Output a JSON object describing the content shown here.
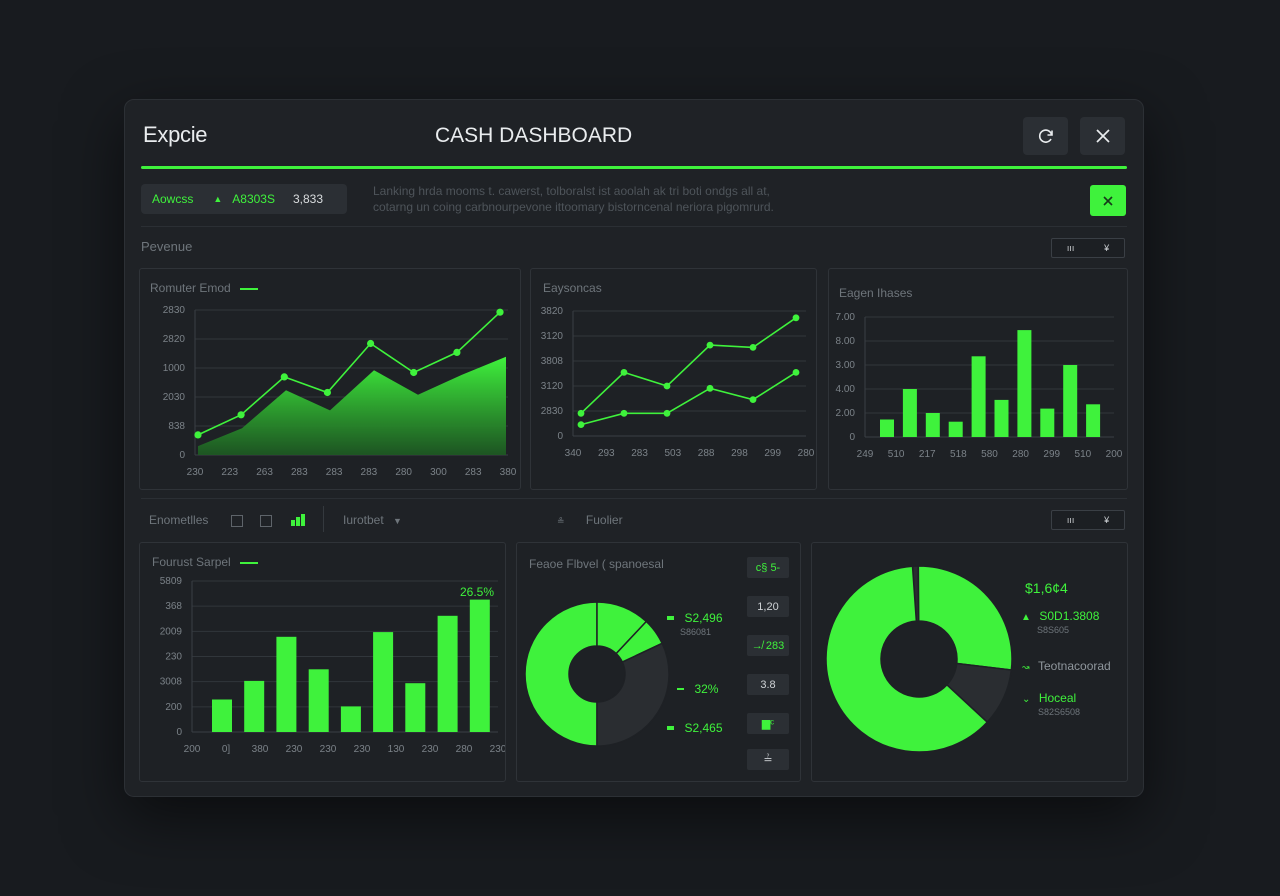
{
  "app": {
    "brand": "Expcie",
    "title": "CASH DASHBOARD"
  },
  "header": {
    "refresh_icon": "refresh-icon",
    "close_icon": "close-icon"
  },
  "summary": {
    "label1": "Aowcss",
    "label2": "A8303S",
    "value": "3,833",
    "description_line1": "Lanking hrda mooms t. cawerst, tolboralst ist aoolah ak tri boti ondgs all at,",
    "description_line2": "cotarng un coing carbnourpevone ittoomary bistorncenal neriora pigomrurd."
  },
  "sections": {
    "top": {
      "label": "Pevenue",
      "control_left": "ııı",
      "control_right": "¥"
    },
    "bottom": {
      "label": "Enometlles",
      "filter_label": "Iurotbet",
      "other_label": "Fuolier",
      "control_left": "ııı",
      "control_right": "¥"
    }
  },
  "colors": {
    "accent": "#3ff23c",
    "panel": "#1e2125",
    "grid": "#31363b"
  },
  "chart_data": [
    {
      "type": "area",
      "title": "Romuter Emod",
      "y_ticks": [
        "2830",
        "2820",
        "1000",
        "2030",
        "838",
        "0"
      ],
      "x_ticks": [
        "230",
        "223",
        "263",
        "283",
        "283",
        "283",
        "280",
        "300",
        "283",
        "380"
      ],
      "series": [
        {
          "values": [
            0.9,
            1.8,
            3.5,
            2.8,
            5.0,
            3.7,
            4.6,
            6.4
          ]
        },
        {
          "values": [
            0.4,
            1.2,
            2.9,
            2.0,
            3.8,
            2.7,
            3.6,
            4.4
          ]
        }
      ],
      "ylim": [
        0,
        6.5
      ]
    },
    {
      "type": "line",
      "title": "Eaysoncas",
      "y_ticks": [
        "3820",
        "3120",
        "3808",
        "3120",
        "2830",
        "0"
      ],
      "x_ticks": [
        "340",
        "293",
        "283",
        "503",
        "288",
        "298",
        "299",
        "280"
      ],
      "series": [
        {
          "values": [
            1.0,
            2.8,
            2.2,
            4.0,
            3.9,
            5.2
          ]
        },
        {
          "values": [
            0.5,
            1.0,
            1.0,
            2.1,
            1.6,
            2.8
          ]
        }
      ],
      "ylim": [
        0,
        5.5
      ]
    },
    {
      "type": "bar",
      "title": "Eagen Ihases",
      "y_ticks": [
        "7.00",
        "8.00",
        "3.00",
        "4.00",
        "2.00",
        "0"
      ],
      "x_ticks": [
        "249",
        "510",
        "217",
        "518",
        "580",
        "280",
        "299",
        "510",
        "200"
      ],
      "values": [
        0.8,
        2.2,
        1.1,
        0.7,
        3.7,
        1.7,
        4.9,
        1.3,
        3.3,
        1.5
      ],
      "ylim": [
        0,
        5.5
      ]
    },
    {
      "type": "bar",
      "title": "Fourust Sarpel",
      "annotation": "26.5%",
      "y_ticks": [
        "5809",
        "368",
        "2009",
        "230",
        "3008",
        "200",
        "0"
      ],
      "x_ticks": [
        "200",
        "0]",
        "380",
        "230",
        "230",
        "230",
        "130",
        "230",
        "280",
        "230"
      ],
      "values": [
        1.4,
        2.2,
        4.1,
        2.7,
        1.1,
        4.3,
        2.1,
        5.0,
        5.7
      ],
      "ylim": [
        0,
        6.5
      ]
    },
    {
      "type": "pie",
      "title": "Feaoe Flbvel ( spanoesal",
      "slices": [
        50,
        12,
        6,
        32
      ],
      "legend": [
        {
          "value": "S2,496",
          "sub": "S86081"
        },
        {
          "value": "32%",
          "sub": ""
        },
        {
          "value": "S2,465",
          "sub": ""
        }
      ],
      "side_buttons": [
        "c§ 5-",
        "1,20",
        "↛ 283",
        "3.8",
        "▆ᶜ",
        "≟"
      ]
    },
    {
      "type": "pie",
      "title": "",
      "slices": [
        1,
        27,
        10,
        62
      ],
      "legend": [
        {
          "value": "$1,6¢4",
          "sub": ""
        },
        {
          "value": "S0D1.3808",
          "sub": "S8S605"
        },
        {
          "value": "Teotnacoorad",
          "sub": ""
        },
        {
          "value": "Hoceal",
          "sub": "S82S6508"
        }
      ]
    }
  ]
}
